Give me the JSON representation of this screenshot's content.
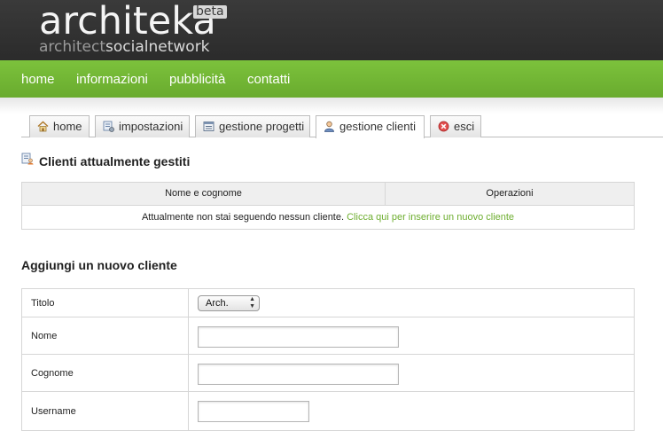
{
  "logo": {
    "main": "architeka",
    "beta": "beta",
    "tag_part1": "architect",
    "tag_part2": "socialnetwork"
  },
  "nav": {
    "items": [
      "home",
      "informazioni",
      "pubblicità",
      "contatti"
    ]
  },
  "tabs": [
    {
      "label": "home",
      "icon": "house-icon"
    },
    {
      "label": "impostazioni",
      "icon": "settings-icon"
    },
    {
      "label": "gestione progetti",
      "icon": "projects-icon"
    },
    {
      "label": "gestione clienti",
      "icon": "client-icon",
      "active": true
    },
    {
      "label": "esci",
      "icon": "exit-icon"
    }
  ],
  "clients": {
    "title": "Clienti attualmente gestiti",
    "columns": [
      "Nome e cognome",
      "Operazioni"
    ],
    "empty_text": "Attualmente non stai seguendo nessun cliente.",
    "empty_link": "Clicca qui per inserire un nuovo cliente"
  },
  "add_form": {
    "title": "Aggiungi un nuovo cliente",
    "fields": [
      {
        "label": "Titolo",
        "type": "select",
        "value": "Arch."
      },
      {
        "label": "Nome",
        "type": "text",
        "value": ""
      },
      {
        "label": "Cognome",
        "type": "text",
        "value": ""
      },
      {
        "label": "Username",
        "type": "text",
        "value": ""
      }
    ]
  },
  "colors": {
    "header_bg": "#2f2f2f",
    "nav_green": "#74b835",
    "link_green": "#6eae30"
  }
}
